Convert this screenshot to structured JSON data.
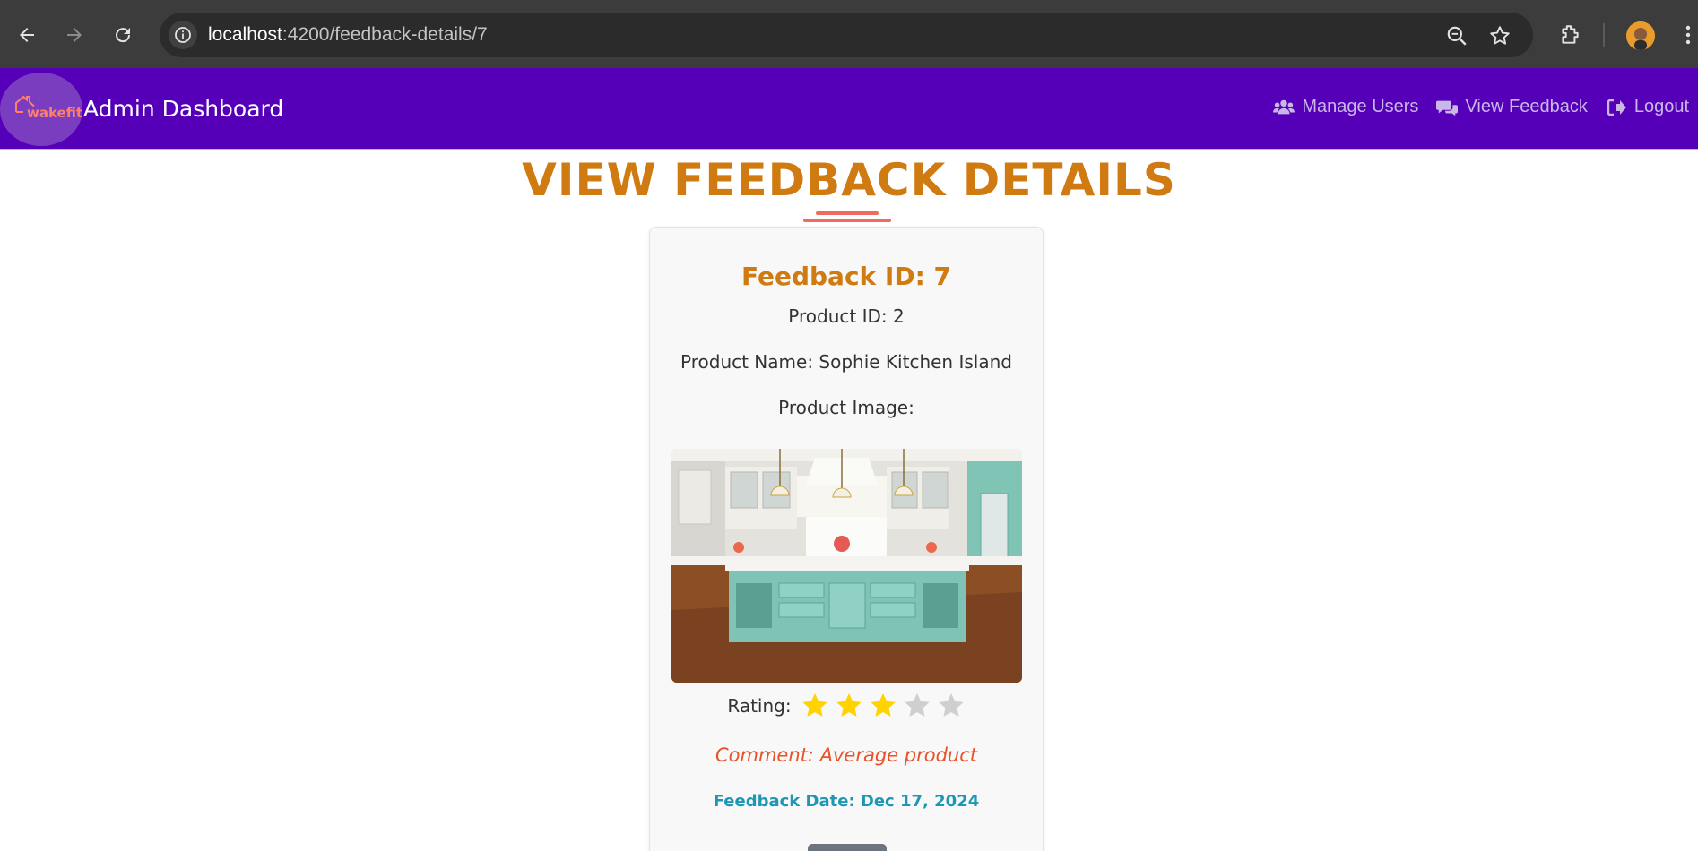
{
  "browser": {
    "url_host": "localhost",
    "url_path": ":4200/feedback-details/7"
  },
  "navbar": {
    "logo_text": "wakefit",
    "brand_title": "Admin Dashboard",
    "links": [
      {
        "label": "Manage Users",
        "icon": "users-icon"
      },
      {
        "label": "View Feedback",
        "icon": "comments-icon"
      },
      {
        "label": "Logout",
        "icon": "logout-icon"
      }
    ]
  },
  "page": {
    "title": "VIEW FEEDBACK DETAILS"
  },
  "feedback": {
    "id_label": "Feedback ID: 7",
    "product_id_label": "Product ID: 2",
    "product_name_label": "Product Name: Sophie Kitchen Island",
    "product_image_label": "Product Image:",
    "rating_label": "Rating:",
    "rating_value": 3,
    "rating_max": 5,
    "comment_label": "Comment: Average product",
    "date_label": "Feedback Date: Dec 17, 2024"
  },
  "colors": {
    "navbar_bg": "#5500b8",
    "title": "#d07a12",
    "star_filled": "#ffd200",
    "star_empty": "#cfcfcf",
    "comment": "#e8522a",
    "date": "#1f97b4"
  }
}
